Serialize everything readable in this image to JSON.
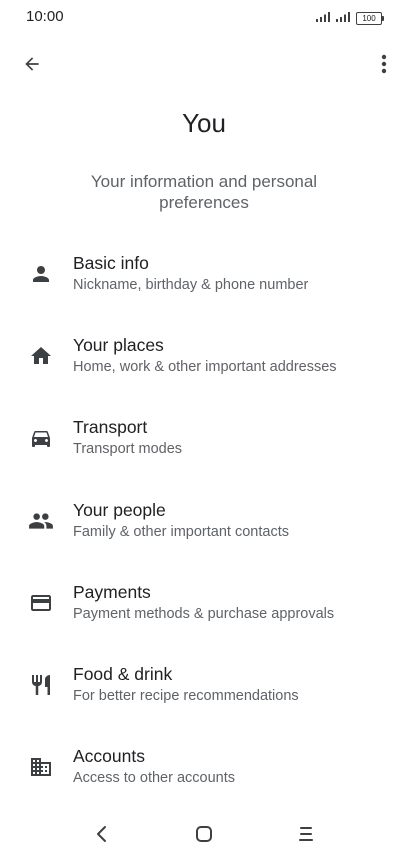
{
  "status_bar": {
    "time": "10:00",
    "battery": "100"
  },
  "page": {
    "title": "You",
    "subtitle": "Your information and personal preferences"
  },
  "menu": [
    {
      "title": "Basic info",
      "description": "Nickname, birthday & phone number",
      "icon": "person-icon"
    },
    {
      "title": "Your places",
      "description": "Home, work & other important addresses",
      "icon": "home-icon"
    },
    {
      "title": "Transport",
      "description": "Transport modes",
      "icon": "car-icon"
    },
    {
      "title": "Your people",
      "description": "Family & other important contacts",
      "icon": "people-icon"
    },
    {
      "title": "Payments",
      "description": "Payment methods & purchase approvals",
      "icon": "credit-card-icon"
    },
    {
      "title": "Food & drink",
      "description": "For better recipe recommendations",
      "icon": "restaurant-icon"
    },
    {
      "title": "Accounts",
      "description": "Access to other accounts",
      "icon": "building-icon"
    }
  ],
  "colors": {
    "primary_text": "#202124",
    "secondary_text": "#5f6368",
    "icon": "#3c4043",
    "background": "#ffffff"
  }
}
